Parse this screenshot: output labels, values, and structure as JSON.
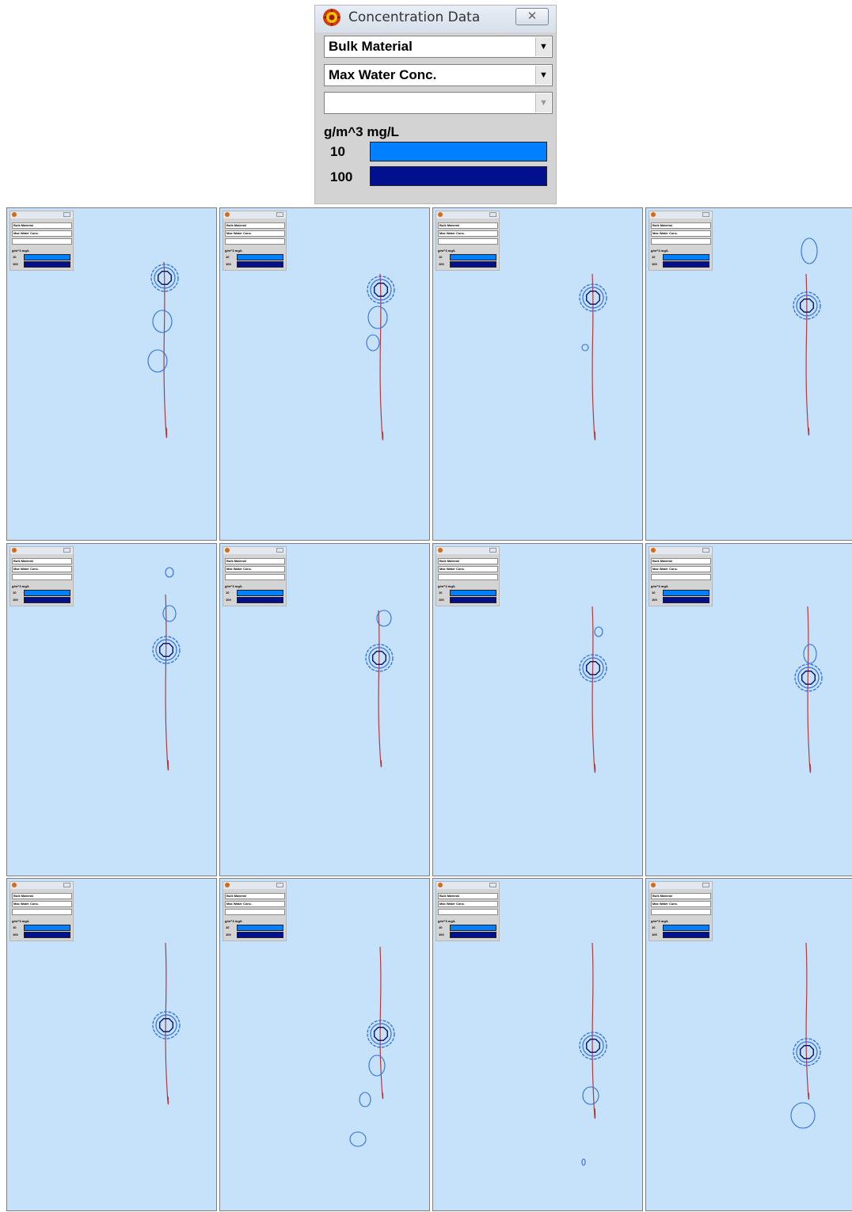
{
  "window": {
    "title": "Concentration Data",
    "close_icon": "close-icon",
    "dropdowns": [
      {
        "value": "Bulk Material"
      },
      {
        "value": "Max Water Conc."
      },
      {
        "value": ""
      }
    ],
    "units": "g/m^3 mg/L",
    "legend": [
      {
        "label": "10",
        "color": "#0080ff"
      },
      {
        "label": "100",
        "color": "#00108f"
      }
    ]
  },
  "colors": {
    "frame_background": "#c5e2fa",
    "track": "#b33a3a",
    "contour_outer": "#2f6fe0",
    "contour_inner": "#101a70"
  },
  "frames_count": 12
}
